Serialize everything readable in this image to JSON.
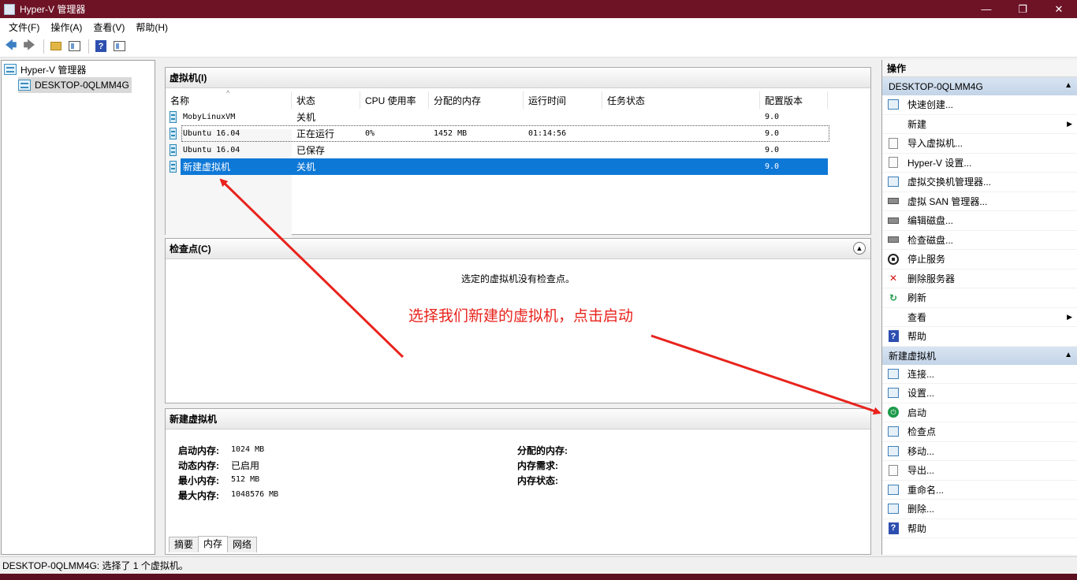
{
  "window": {
    "title": "Hyper-V 管理器",
    "minimize": "—",
    "maximize": "❐",
    "close": "✕",
    "accent_color": "#6e1326"
  },
  "menu": [
    "文件(F)",
    "操作(A)",
    "查看(V)",
    "帮助(H)"
  ],
  "toolbar": {
    "icons": [
      "back-arrow-icon",
      "forward-arrow-icon",
      "folder-up-icon",
      "show-hide-console-tree-icon",
      "help-icon",
      "show-hide-action-pane-icon"
    ]
  },
  "tree": {
    "root": "Hyper-V 管理器",
    "server": "DESKTOP-0QLMM4G"
  },
  "vm_panel": {
    "title": "虚拟机(I)",
    "columns": [
      "名称",
      "状态",
      "CPU 使用率",
      "分配的内存",
      "运行时间",
      "任务状态",
      "配置版本"
    ],
    "rows": [
      {
        "name": "MobyLinuxVM",
        "state": "关机",
        "cpu": "",
        "memory": "",
        "uptime": "",
        "task": "",
        "version": "9.0"
      },
      {
        "name": "Ubuntu 16.04",
        "state": "正在运行",
        "cpu": "0%",
        "memory": "1452 MB",
        "uptime": "01:14:56",
        "task": "",
        "version": "9.0"
      },
      {
        "name": "Ubuntu 16.04",
        "state": "已保存",
        "cpu": "",
        "memory": "",
        "uptime": "",
        "task": "",
        "version": "9.0"
      },
      {
        "name": "新建虚拟机",
        "state": "关机",
        "cpu": "",
        "memory": "",
        "uptime": "",
        "task": "",
        "version": "9.0"
      }
    ],
    "selected_row": 3,
    "selection_color": "#0e78d7"
  },
  "checkpoint_panel": {
    "title": "检查点(C)",
    "empty_message": "选定的虚拟机没有检查点。"
  },
  "details_panel": {
    "title": "新建虚拟机",
    "left": [
      {
        "label": "启动内存:",
        "value": "1024 MB"
      },
      {
        "label": "动态内存:",
        "value": "已启用"
      },
      {
        "label": "最小内存:",
        "value": "512 MB"
      },
      {
        "label": "最大内存:",
        "value": "1048576 MB"
      }
    ],
    "right": [
      {
        "label": "分配的内存:",
        "value": ""
      },
      {
        "label": "内存需求:",
        "value": ""
      },
      {
        "label": "内存状态:",
        "value": ""
      }
    ],
    "tabs": [
      "摘要",
      "内存",
      "网络"
    ],
    "active_tab": 1
  },
  "actions": {
    "title": "操作",
    "server_group": {
      "title": "DESKTOP-0QLMM4G",
      "items": [
        {
          "label": "快速创建...",
          "icon": "quick-create-icon"
        },
        {
          "label": "新建",
          "icon": "",
          "submenu": true
        },
        {
          "label": "导入虚拟机...",
          "icon": "import-vm-icon"
        },
        {
          "label": "Hyper-V 设置...",
          "icon": "settings-icon"
        },
        {
          "label": "虚拟交换机管理器...",
          "icon": "virtual-switch-icon"
        },
        {
          "label": "虚拟 SAN 管理器...",
          "icon": "virtual-san-icon"
        },
        {
          "label": "编辑磁盘...",
          "icon": "edit-disk-icon"
        },
        {
          "label": "检查磁盘...",
          "icon": "inspect-disk-icon"
        },
        {
          "label": "停止服务",
          "icon": "stop-service-icon"
        },
        {
          "label": "删除服务器",
          "icon": "remove-server-icon"
        },
        {
          "label": "刷新",
          "icon": "refresh-icon"
        },
        {
          "label": "查看",
          "icon": "",
          "submenu": true
        },
        {
          "label": "帮助",
          "icon": "help-icon"
        }
      ]
    },
    "vm_group": {
      "title": "新建虚拟机",
      "items": [
        {
          "label": "连接...",
          "icon": "connect-icon"
        },
        {
          "label": "设置...",
          "icon": "vm-settings-icon"
        },
        {
          "label": "启动",
          "icon": "start-icon"
        },
        {
          "label": "检查点",
          "icon": "checkpoint-icon"
        },
        {
          "label": "移动...",
          "icon": "move-icon"
        },
        {
          "label": "导出...",
          "icon": "export-icon"
        },
        {
          "label": "重命名...",
          "icon": "rename-icon"
        },
        {
          "label": "删除...",
          "icon": "delete-icon"
        },
        {
          "label": "帮助",
          "icon": "help-icon"
        }
      ]
    }
  },
  "status": {
    "text": "DESKTOP-0QLMM4G:  选择了 1 个虚拟机。"
  },
  "annotation": {
    "text": "选择我们新建的虚拟机，点击启动",
    "color": "#e8231c"
  }
}
